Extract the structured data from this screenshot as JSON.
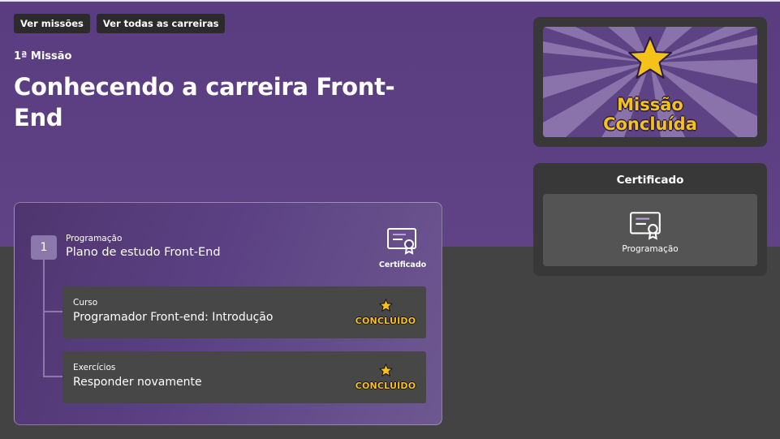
{
  "header": {
    "buttons": [
      "Ver missões",
      "Ver todas as carreiras"
    ],
    "mission_number": "1ª Missão",
    "title": "Conhecendo a carreira Front-End"
  },
  "mission": {
    "step_number": "1",
    "category": "Programação",
    "name": "Plano de estudo Front-End",
    "certificate_label": "Certificado",
    "items": [
      {
        "category": "Curso",
        "name": "Programador Front-end: Introdução",
        "status": "CONCLUÍDO"
      },
      {
        "category": "Exercícios",
        "name": "Responder novamente",
        "status": "CONCLUÍDO"
      }
    ]
  },
  "completion": {
    "line1": "Missão",
    "line2": "Concluída"
  },
  "certificate_panel": {
    "title": "Certificado",
    "item": "Programação"
  },
  "colors": {
    "hero_purple": "#5e4285",
    "star_gold": "#f5c21a",
    "panel_dark": "#383838",
    "page_gray": "#434343"
  }
}
